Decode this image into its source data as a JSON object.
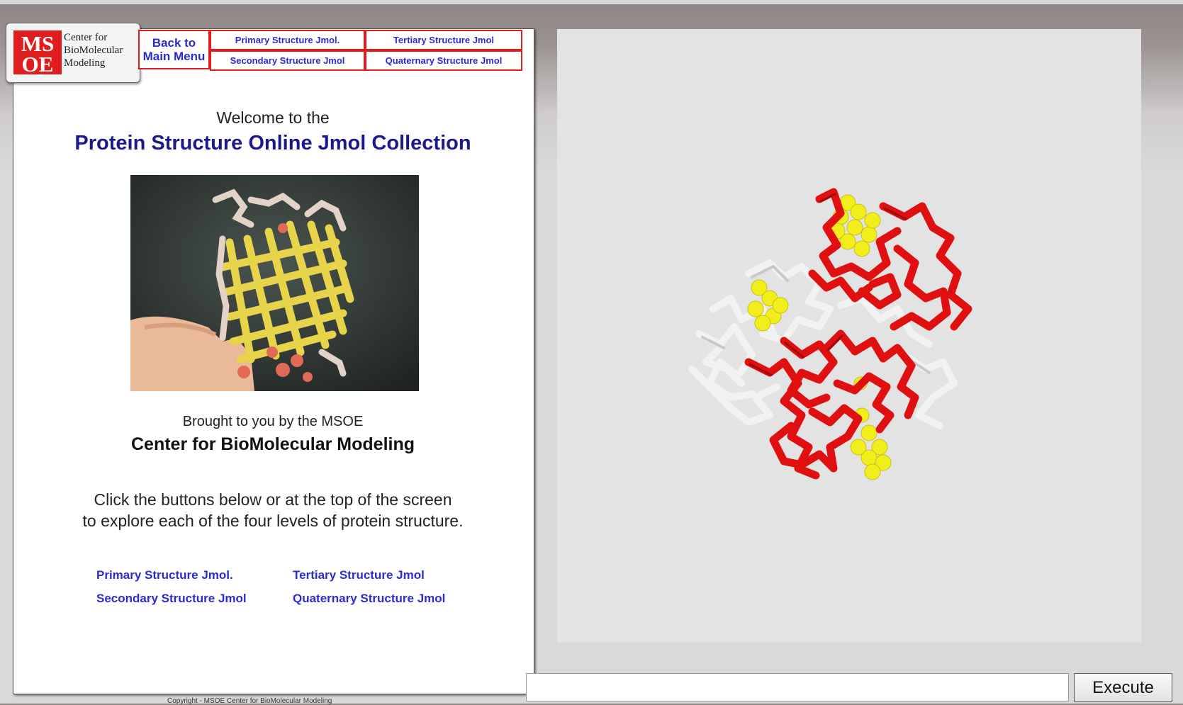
{
  "logo": {
    "letters": "MSOE",
    "line1": "Center for",
    "line2": "BioMolecular",
    "line3": "Modeling",
    "colors": {
      "brand_red": "#e11c1c"
    }
  },
  "nav": {
    "back_line1": "Back to",
    "back_line2": "Main Menu",
    "primary": "Primary Structure Jmol.",
    "secondary": "Secondary Structure Jmol",
    "tertiary": "Tertiary Structure Jmol",
    "quaternary": "Quaternary Structure Jmol"
  },
  "content": {
    "welcome": "Welcome to the",
    "title": "Protein Structure Online Jmol Collection",
    "brought": "Brought to you by the MSOE",
    "center": "Center for BioMolecular Modeling",
    "instruct_line1": "Click the buttons below or at the top of the screen",
    "instruct_line2": "to explore each of the four levels of protein structure."
  },
  "links": {
    "primary": "Primary Structure Jmol.",
    "secondary": "Secondary Structure Jmol",
    "tertiary": "Tertiary Structure Jmol",
    "quaternary": "Quaternary Structure Jmol"
  },
  "footer": {
    "copyright": "Copyright - MSOE Center for BioMolecular Modeling"
  },
  "console": {
    "input_value": "",
    "execute_label": "Execute"
  },
  "colors": {
    "title_blue": "#1a1a8c",
    "link_blue": "#2b2bd4",
    "nav_border": "#e11c1c",
    "molecule_red": "#e01010",
    "molecule_yellow": "#f2ee1c",
    "molecule_white": "#f0f0f0"
  }
}
